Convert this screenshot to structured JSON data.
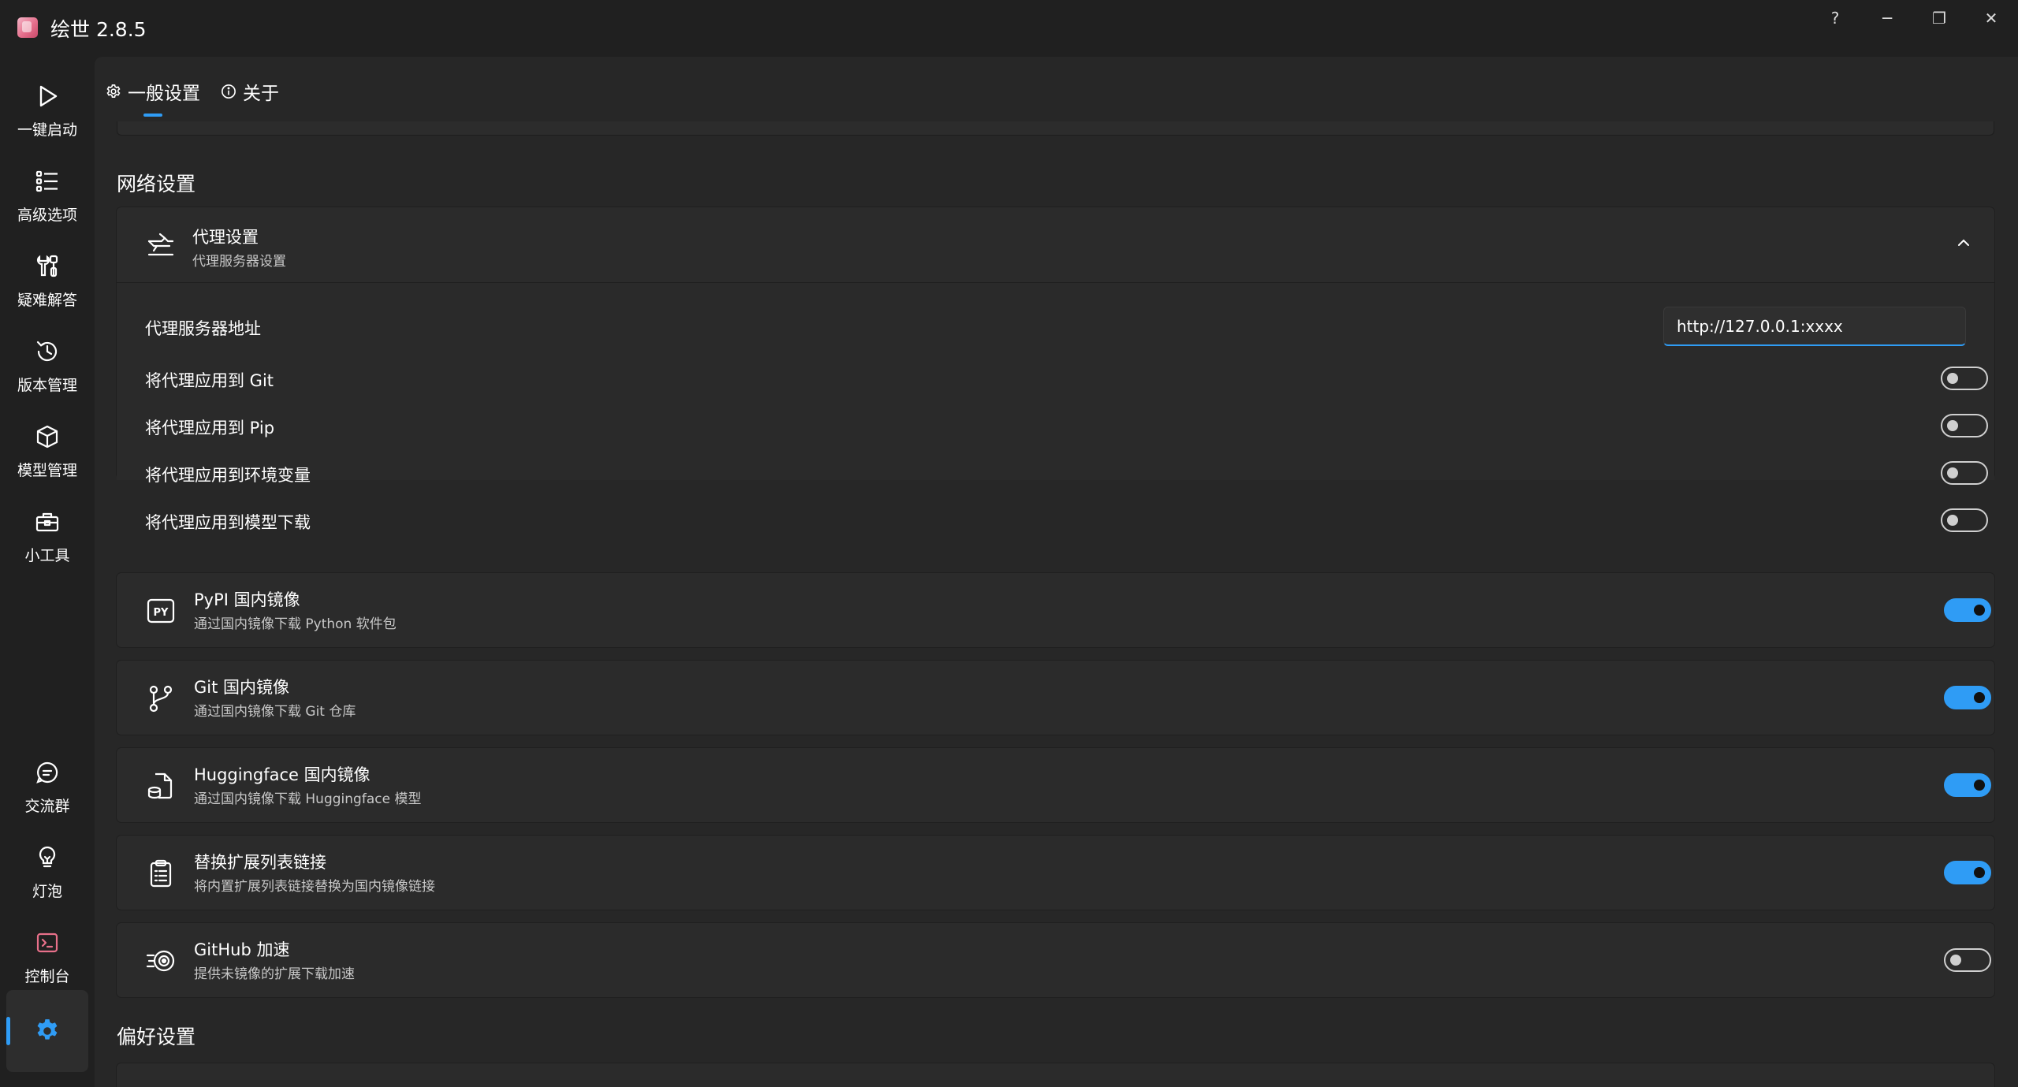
{
  "app": {
    "title": "绘世 2.8.5"
  },
  "window_controls": {
    "help": "?",
    "minimize": "─",
    "maximize": "❐",
    "close": "✕"
  },
  "sidebar": {
    "items": [
      {
        "label": "一键启动",
        "icon": "play-icon"
      },
      {
        "label": "高级选项",
        "icon": "list-icon"
      },
      {
        "label": "疑难解答",
        "icon": "tools-icon"
      },
      {
        "label": "版本管理",
        "icon": "history-icon"
      },
      {
        "label": "模型管理",
        "icon": "cube-icon"
      },
      {
        "label": "小工具",
        "icon": "toolbox-icon"
      }
    ],
    "bottom_items": [
      {
        "label": "交流群",
        "icon": "chat-icon"
      },
      {
        "label": "灯泡",
        "icon": "lightbulb-icon"
      },
      {
        "label": "控制台",
        "icon": "console-icon"
      }
    ],
    "active_item": {
      "icon": "settings-gear-icon",
      "accent": "#2f9cf5"
    }
  },
  "tabs": [
    {
      "label": "一般设置",
      "icon": "gear-icon",
      "selected": true
    },
    {
      "label": "关于",
      "icon": "info-icon",
      "selected": false
    }
  ],
  "network": {
    "section_title": "网络设置",
    "proxy": {
      "title": "代理设置",
      "description": "代理服务器设置",
      "expanded": true,
      "address_label": "代理服务器地址",
      "address_value": "http://127.0.0.1:xxxx",
      "options": [
        {
          "label": "将代理应用到 Git",
          "enabled": false
        },
        {
          "label": "将代理应用到 Pip",
          "enabled": false
        },
        {
          "label": "将代理应用到环境变量",
          "enabled": false
        },
        {
          "label": "将代理应用到模型下载",
          "enabled": false
        }
      ]
    },
    "cards": [
      {
        "title": "PyPI 国内镜像",
        "description": "通过国内镜像下载 Python 软件包",
        "icon": "pypi-icon",
        "enabled": true
      },
      {
        "title": "Git 国内镜像",
        "description": "通过国内镜像下载 Git 仓库",
        "icon": "git-branch-icon",
        "enabled": true
      },
      {
        "title": "Huggingface 国内镜像",
        "description": "通过国内镜像下载 Huggingface 模型",
        "icon": "model-file-icon",
        "enabled": true
      },
      {
        "title": "替换扩展列表链接",
        "description": "将内置扩展列表链接替换为国内镜像链接",
        "icon": "clipboard-list-icon",
        "enabled": true
      },
      {
        "title": "GitHub 加速",
        "description": "提供未镜像的扩展下载加速",
        "icon": "speed-icon",
        "enabled": false
      }
    ]
  },
  "preferences": {
    "section_title": "偏好设置"
  },
  "colors": {
    "accent": "#2f9cf5",
    "background": "#202020",
    "card": "#2b2b2b"
  }
}
